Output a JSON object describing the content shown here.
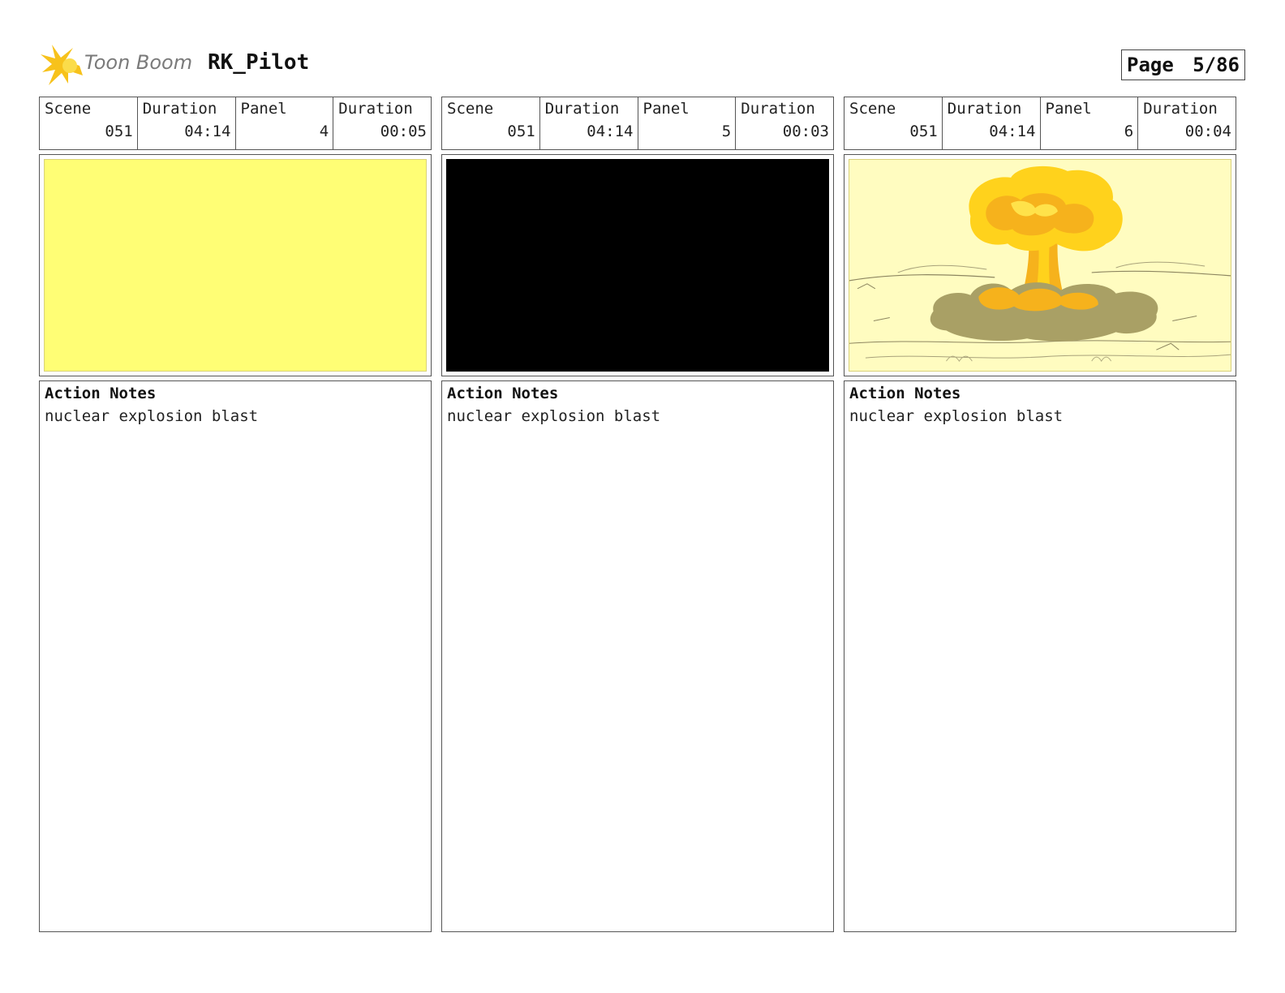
{
  "header": {
    "logo_text": "Toon Boom",
    "project_title": "RK_Pilot",
    "page_label": "Page",
    "page_value": "5/86"
  },
  "panels": [
    {
      "scene_label": "Scene",
      "scene": "051",
      "duration_label": "Duration",
      "scene_duration": "04:14",
      "panel_label": "Panel",
      "panel": "4",
      "panel_duration_label": "Duration",
      "panel_duration": "00:05",
      "frame": "solid yellow",
      "notes_label": "Action Notes",
      "notes": "nuclear explosion blast"
    },
    {
      "scene_label": "Scene",
      "scene": "051",
      "duration_label": "Duration",
      "scene_duration": "04:14",
      "panel_label": "Panel",
      "panel": "5",
      "panel_duration_label": "Duration",
      "panel_duration": "00:03",
      "frame": "solid black",
      "notes_label": "Action Notes",
      "notes": "nuclear explosion blast"
    },
    {
      "scene_label": "Scene",
      "scene": "051",
      "duration_label": "Duration",
      "scene_duration": "04:14",
      "panel_label": "Panel",
      "panel": "6",
      "panel_duration_label": "Duration",
      "panel_duration": "00:04",
      "frame": "mushroom cloud drawing",
      "notes_label": "Action Notes",
      "notes": "nuclear explosion blast"
    }
  ],
  "colors": {
    "yellow_frame": "#fffe75",
    "black_frame": "#000000",
    "art_background": "#fffcc0",
    "cloud_yellow": "#ffd21c",
    "cloud_orange": "#f6b21c",
    "smoke_olive": "#a9a065",
    "logo_yellow": "#f7c21b"
  }
}
